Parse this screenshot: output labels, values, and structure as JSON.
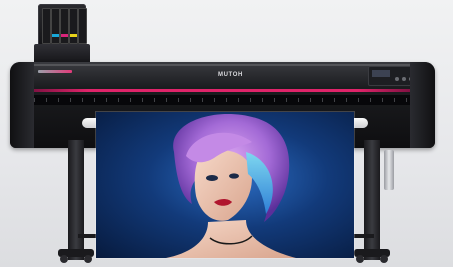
{
  "brand": {
    "logo_text": "MUTOH"
  },
  "colors": {
    "accent_stripe": "#e0246a",
    "body": "#1b1c1f",
    "print_background": "#123a7a",
    "hair": "#a36ad6"
  },
  "ink_cartridges": [
    {
      "color": "#1a1a1d"
    },
    {
      "color": "#18a7d8"
    },
    {
      "color": "#d8247a"
    },
    {
      "color": "#e8d21a"
    },
    {
      "color": "#1a1a1d"
    }
  ],
  "icons": {
    "control_panel": "control-panel-icon"
  }
}
